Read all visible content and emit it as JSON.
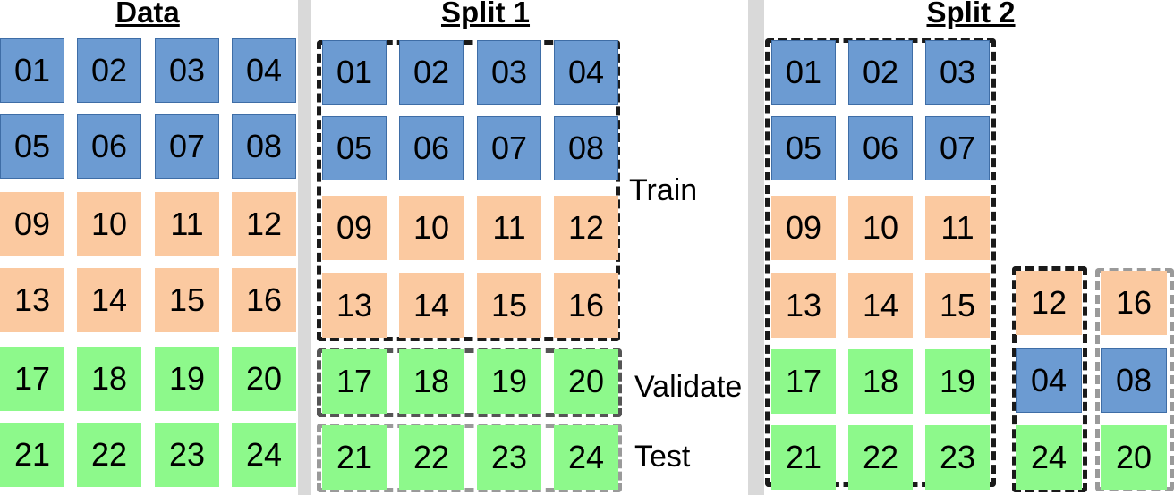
{
  "colors": {
    "blue": "#6c9bd2",
    "orange": "#fbc9a0",
    "green": "#8df98b"
  },
  "panels": {
    "data_title": "Data",
    "split1_title": "Split 1",
    "split2_title": "Split 2"
  },
  "labels": {
    "train": "Train",
    "validate": "Validate",
    "test": "Test"
  },
  "data_grid": [
    [
      "01",
      "02",
      "03",
      "04"
    ],
    [
      "05",
      "06",
      "07",
      "08"
    ],
    [
      "09",
      "10",
      "11",
      "12"
    ],
    [
      "13",
      "14",
      "15",
      "16"
    ],
    [
      "17",
      "18",
      "19",
      "20"
    ],
    [
      "21",
      "22",
      "23",
      "24"
    ]
  ],
  "split1": {
    "train": [
      [
        "01",
        "02",
        "03",
        "04"
      ],
      [
        "05",
        "06",
        "07",
        "08"
      ],
      [
        "09",
        "10",
        "11",
        "12"
      ],
      [
        "13",
        "14",
        "15",
        "16"
      ]
    ],
    "validate": [
      "17",
      "18",
      "19",
      "20"
    ],
    "test": [
      "21",
      "22",
      "23",
      "24"
    ]
  },
  "split2": {
    "train": [
      [
        "01",
        "02",
        "03"
      ],
      [
        "05",
        "06",
        "07"
      ],
      [
        "09",
        "10",
        "11"
      ],
      [
        "13",
        "14",
        "15"
      ],
      [
        "17",
        "18",
        "19"
      ],
      [
        "21",
        "22",
        "23"
      ]
    ],
    "column_a": [
      "12",
      "04",
      "24"
    ],
    "column_b": [
      "16",
      "08",
      "20"
    ]
  }
}
